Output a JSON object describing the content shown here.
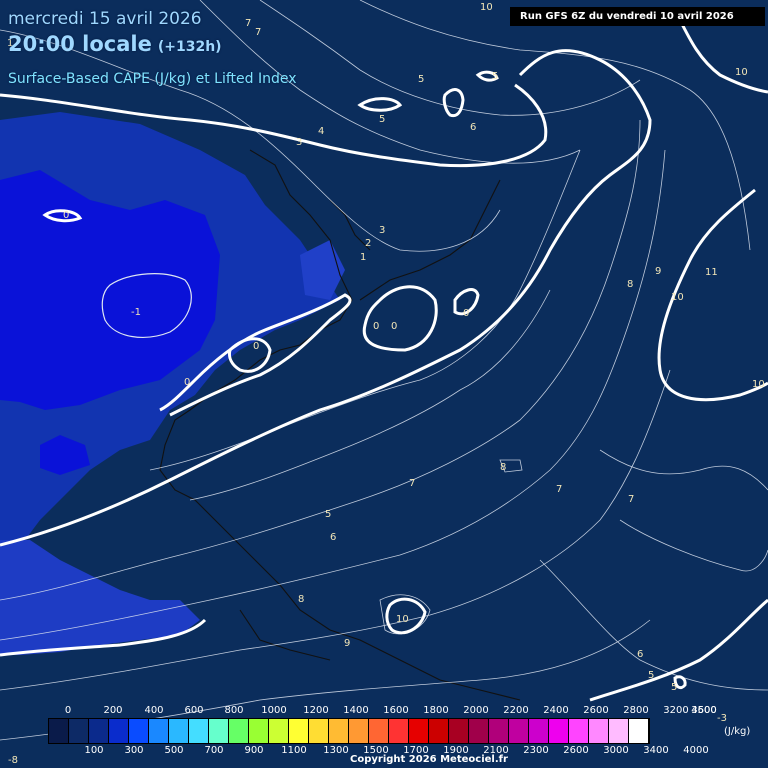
{
  "header": {
    "date": "mercredi 15 avril 2026",
    "time": "20:00 locale",
    "offset": "(+132h)",
    "product": "Surface-Based CAPE (J/kg) et Lifted Index"
  },
  "run_info": "Run GFS 6Z du vendredi 10 avril 2026",
  "legend": {
    "unit": "(J/kg)",
    "top_ticks": [
      "0",
      "200",
      "400",
      "600",
      "800",
      "1000",
      "1200",
      "1400",
      "1600",
      "1800",
      "2000",
      "2200",
      "2400",
      "2600",
      "2800",
      "3200",
      "3600",
      "4500"
    ],
    "bottom_ticks": [
      "100",
      "300",
      "500",
      "700",
      "900",
      "1100",
      "1300",
      "1500",
      "1700",
      "1900",
      "2100",
      "2300",
      "2600",
      "3000",
      "3400",
      "4000"
    ],
    "colors": [
      "#0a1b4a",
      "#0d2a66",
      "#0b2a8c",
      "#0a2ccc",
      "#0a4cff",
      "#1a88ff",
      "#2ab8ff",
      "#44ddff",
      "#66ffcc",
      "#66ff66",
      "#99ff33",
      "#ccff33",
      "#ffff33",
      "#ffdd33",
      "#ffbb33",
      "#ff9933",
      "#ff6633",
      "#ff3333",
      "#e60000",
      "#cc0000",
      "#a80022",
      "#a0004a",
      "#b0007a",
      "#c000a0",
      "#cc00cc",
      "#ee00ee",
      "#ff44ff",
      "#ff88ff",
      "#ffbbff",
      "#ffffff"
    ]
  },
  "contour_labels": [
    "7",
    "7",
    "10",
    "10",
    "1",
    "5",
    "5",
    "5",
    "6",
    "10",
    "4",
    "3",
    "0",
    "2",
    "1",
    "3",
    "8",
    "9",
    "11",
    "10",
    "-1",
    "0",
    "0",
    "0",
    "0",
    "0",
    "10",
    "8",
    "7",
    "7",
    "7",
    "5",
    "6",
    "8",
    "10",
    "9",
    "6",
    "5",
    "5",
    "-3",
    "-8"
  ],
  "copyright": "Copyright 2026 Meteociel.fr"
}
